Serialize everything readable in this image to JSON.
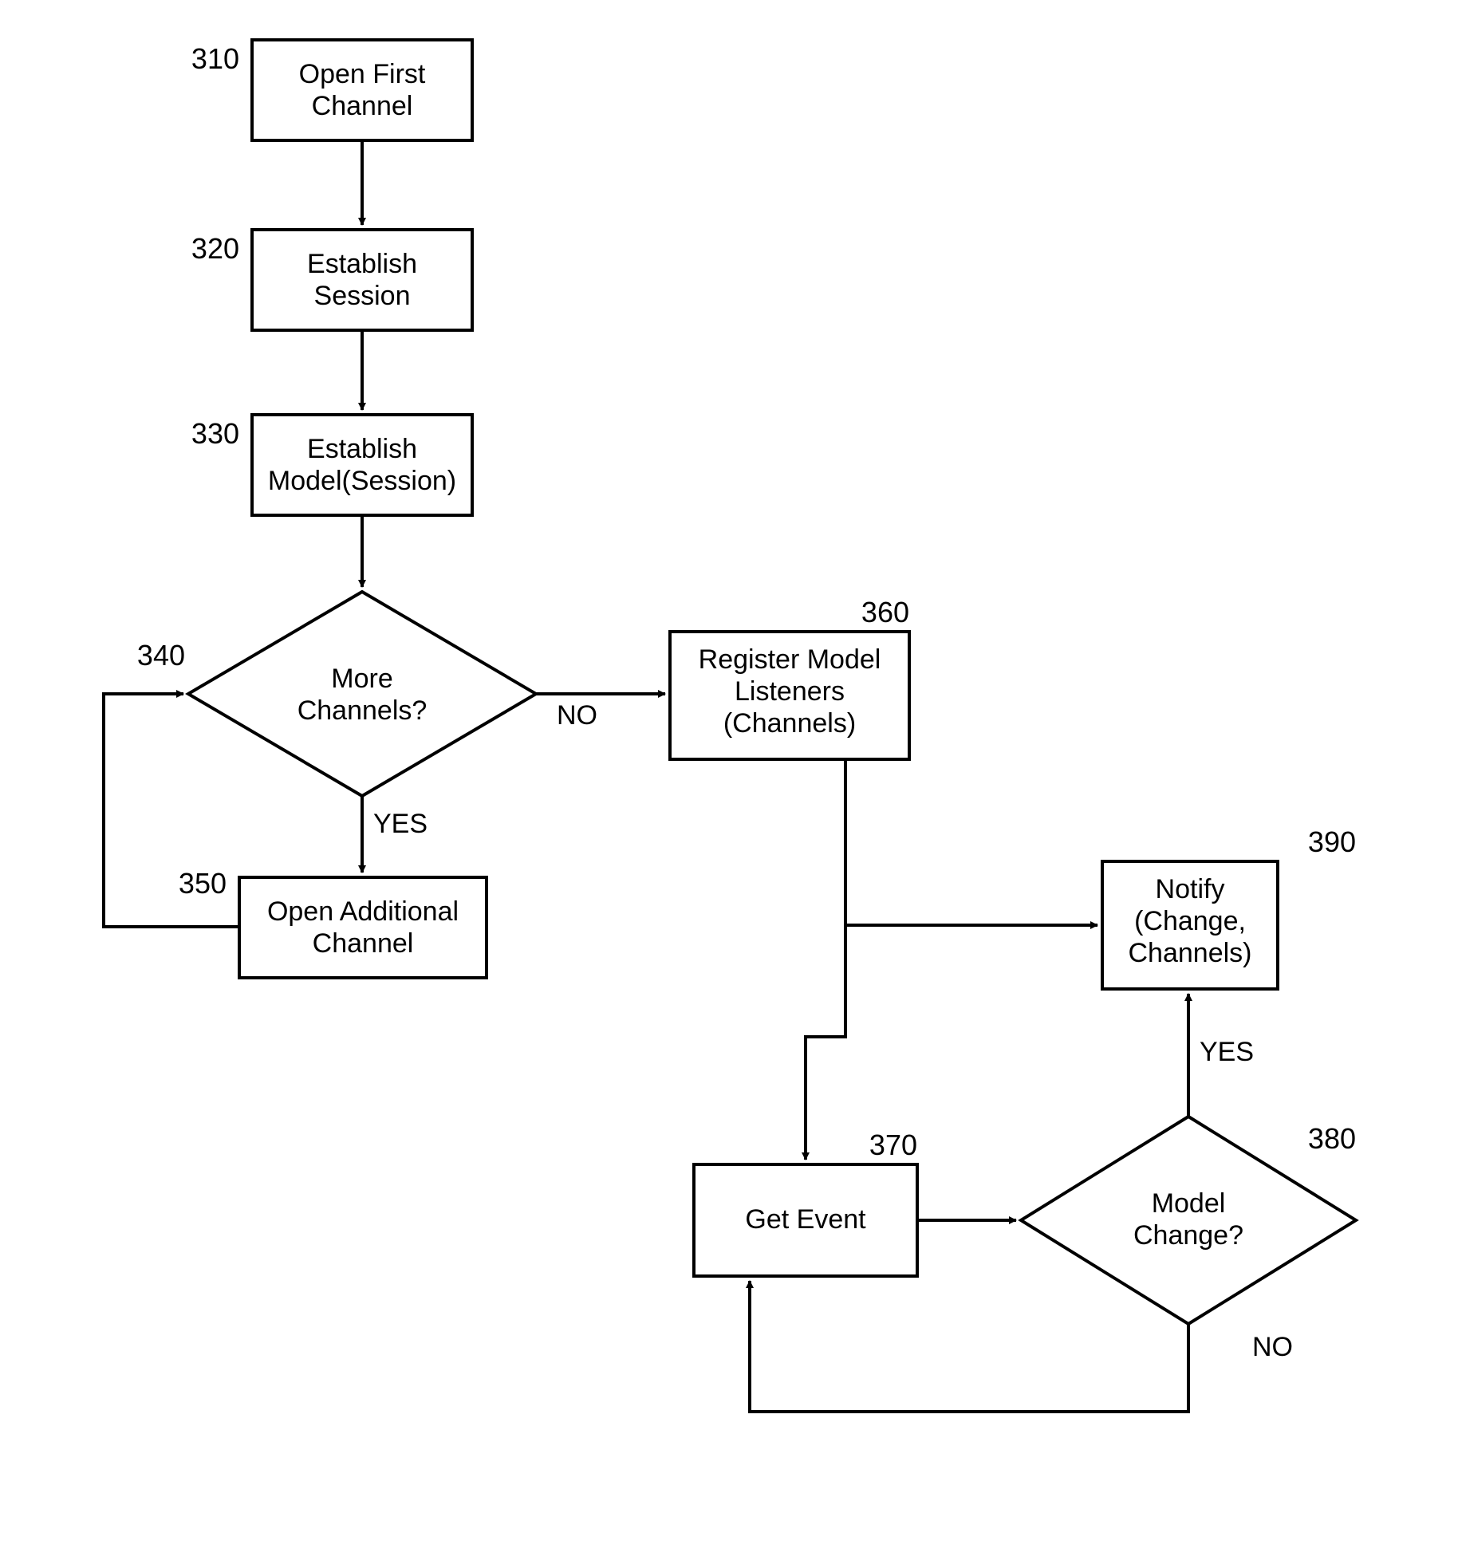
{
  "nodes": {
    "n310": {
      "num": "310",
      "l1": "Open First",
      "l2": "Channel"
    },
    "n320": {
      "num": "320",
      "l1": "Establish",
      "l2": "Session"
    },
    "n330": {
      "num": "330",
      "l1": "Establish",
      "l2": "Model(Session)"
    },
    "n340": {
      "num": "340",
      "l1": "More",
      "l2": "Channels?"
    },
    "n350": {
      "num": "350",
      "l1": "Open Additional",
      "l2": "Channel"
    },
    "n360": {
      "num": "360",
      "l1": "Register Model",
      "l2": "Listeners",
      "l3": "(Channels)"
    },
    "n370": {
      "num": "370",
      "l1": "Get Event"
    },
    "n380": {
      "num": "380",
      "l1": "Model",
      "l2": "Change?"
    },
    "n390": {
      "num": "390",
      "l1": "Notify",
      "l2": "(Change,",
      "l3": "Channels)"
    }
  },
  "labels": {
    "yes340": "YES",
    "no340": "NO",
    "yes380": "YES",
    "no380": "NO"
  }
}
